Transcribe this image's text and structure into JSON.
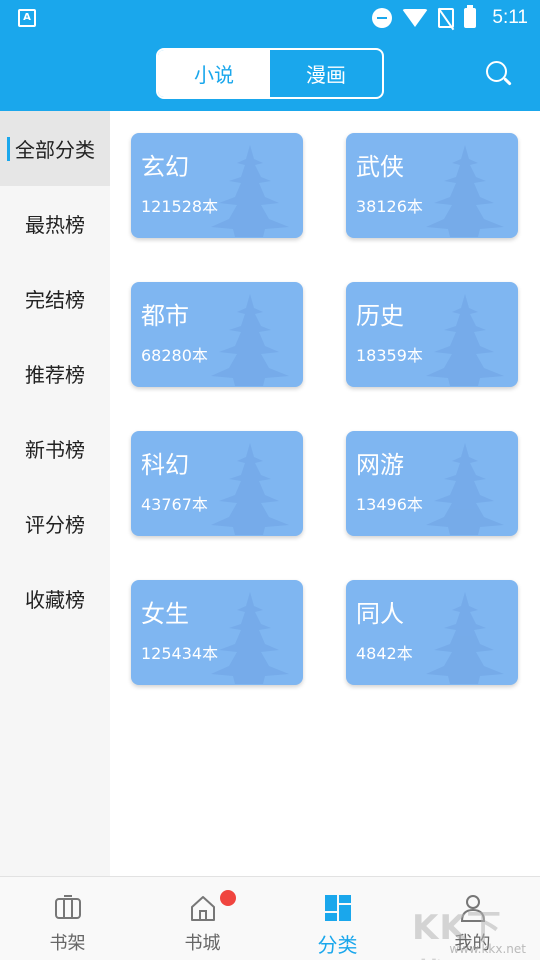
{
  "status_bar": {
    "app_icon_letter": "A",
    "time": "5:11",
    "icons": [
      "app-notification-icon",
      "do-not-disturb-icon",
      "wifi-icon",
      "no-sim-icon",
      "battery-charging-icon"
    ]
  },
  "header": {
    "tabs": [
      {
        "label": "小说",
        "active": true
      },
      {
        "label": "漫画",
        "active": false
      }
    ],
    "search_icon": "search-icon"
  },
  "sidebar": {
    "items": [
      {
        "label": "全部分类",
        "active": true
      },
      {
        "label": "最热榜",
        "active": false
      },
      {
        "label": "完结榜",
        "active": false
      },
      {
        "label": "推荐榜",
        "active": false
      },
      {
        "label": "新书榜",
        "active": false
      },
      {
        "label": "评分榜",
        "active": false
      },
      {
        "label": "收藏榜",
        "active": false
      }
    ]
  },
  "categories": [
    {
      "name": "玄幻",
      "count": "121528本"
    },
    {
      "name": "武侠",
      "count": "38126本"
    },
    {
      "name": "都市",
      "count": "68280本"
    },
    {
      "name": "历史",
      "count": "18359本"
    },
    {
      "name": "科幻",
      "count": "43767本"
    },
    {
      "name": "网游",
      "count": "13496本"
    },
    {
      "name": "女生",
      "count": "125434本"
    },
    {
      "name": "同人",
      "count": "4842本"
    }
  ],
  "bottom_nav": {
    "items": [
      {
        "label": "书架",
        "icon": "bookshelf-icon",
        "active": false
      },
      {
        "label": "书城",
        "icon": "home-icon",
        "active": false,
        "badge": true
      },
      {
        "label": "分类",
        "icon": "category-grid-icon",
        "active": true
      },
      {
        "label": "我的",
        "icon": "user-icon",
        "active": false
      }
    ]
  },
  "watermark": {
    "text": "KK下载",
    "url": "www.kkx.net"
  },
  "colors": {
    "primary": "#1aa7ec",
    "card": "#7fb6f1",
    "badge": "#f0453f"
  }
}
